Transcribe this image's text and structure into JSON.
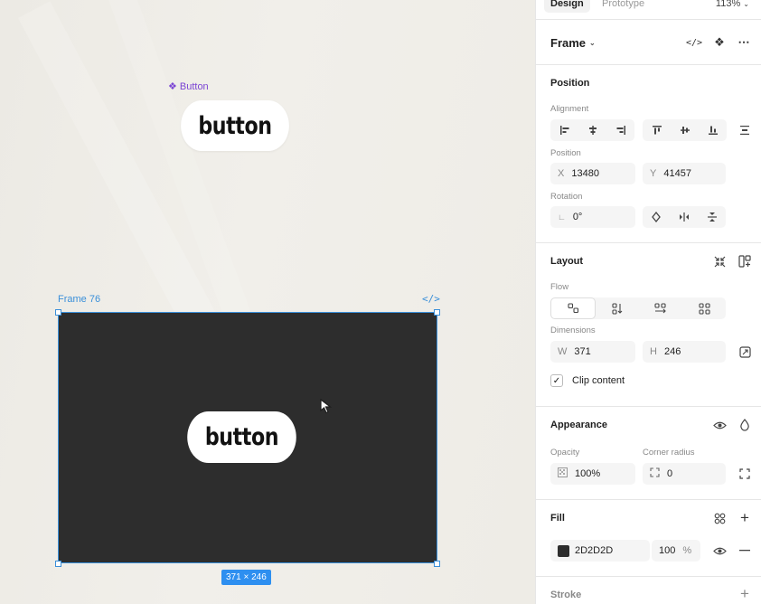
{
  "canvas": {
    "component_label": "Button",
    "component_button_text": "button",
    "frame_label": "Frame 76",
    "frame_code_glyph": "</>",
    "frame_button_text": "button",
    "size_badge": "371 × 246",
    "frame_fill": "#2D2D2D",
    "accent": "#3A8FD9",
    "component_color": "#7B45D4"
  },
  "panel": {
    "tabs": {
      "design": "Design",
      "prototype": "Prototype"
    },
    "zoom": "113%",
    "frame_title": "Frame",
    "position": {
      "title": "Position",
      "alignment_label": "Alignment",
      "position_label": "Position",
      "x_key": "X",
      "x_value": "13480",
      "y_key": "Y",
      "y_value": "41457",
      "rotation_label": "Rotation",
      "rotation_value": "0°"
    },
    "layout": {
      "title": "Layout",
      "flow_label": "Flow",
      "dimensions_label": "Dimensions",
      "w_key": "W",
      "w_value": "371",
      "h_key": "H",
      "h_value": "246",
      "clip_label": "Clip content",
      "clip_checked": "✓"
    },
    "appearance": {
      "title": "Appearance",
      "opacity_label": "Opacity",
      "opacity_value": "100%",
      "radius_label": "Corner radius",
      "radius_value": "0"
    },
    "fill": {
      "title": "Fill",
      "hex": "2D2D2D",
      "opacity": "100",
      "pct": "%"
    },
    "stroke": {
      "title": "Stroke"
    }
  }
}
